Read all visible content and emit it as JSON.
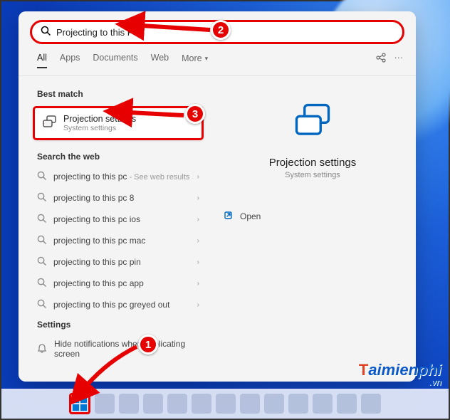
{
  "search": {
    "query": "Projecting to this PC"
  },
  "tabs": {
    "all": "All",
    "apps": "Apps",
    "documents": "Documents",
    "web": "Web",
    "more": "More"
  },
  "sections": {
    "best_match": "Best match",
    "search_web": "Search the web",
    "settings": "Settings"
  },
  "best_match": {
    "title": "Projection settings",
    "subtitle": "System settings"
  },
  "web_results": [
    {
      "text": "projecting to this pc",
      "secondary": " - See web results"
    },
    {
      "text": "projecting to this pc 8",
      "secondary": ""
    },
    {
      "text": "projecting to this pc ios",
      "secondary": ""
    },
    {
      "text": "projecting to this pc mac",
      "secondary": ""
    },
    {
      "text": "projecting to this pc pin",
      "secondary": ""
    },
    {
      "text": "projecting to this pc app",
      "secondary": ""
    },
    {
      "text": "projecting to this pc greyed out",
      "secondary": ""
    }
  ],
  "settings_results": [
    {
      "text": "Hide notifications when duplicating screen"
    }
  ],
  "preview": {
    "title": "Projection settings",
    "subtitle": "System settings",
    "open": "Open"
  },
  "annotations": {
    "b1": "1",
    "b2": "2",
    "b3": "3"
  },
  "watermark": {
    "main": "Taimienphi",
    "sub": ".vn"
  }
}
